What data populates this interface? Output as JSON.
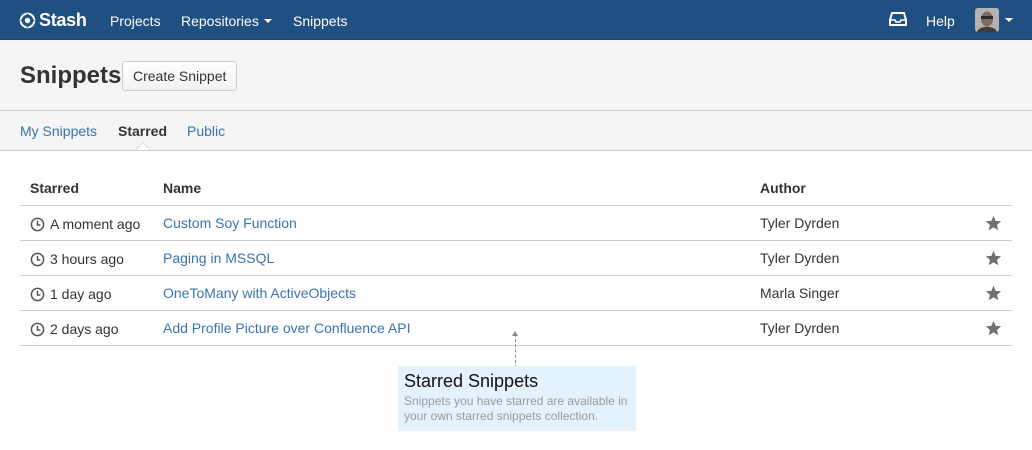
{
  "header": {
    "logo": "Stash",
    "nav": [
      "Projects",
      "Repositories",
      "Snippets"
    ],
    "help": "Help",
    "colors": {
      "bar": "#205081",
      "link": "#3b73af"
    }
  },
  "page": {
    "title": "Snippets",
    "create_button": "Create Snippet"
  },
  "tabs": [
    {
      "label": "My Snippets",
      "active": false
    },
    {
      "label": "Starred",
      "active": true
    },
    {
      "label": "Public",
      "active": false
    }
  ],
  "table": {
    "columns": [
      "Starred",
      "Name",
      "Author"
    ],
    "rows": [
      {
        "starred": "A moment ago",
        "name": "Custom Soy Function",
        "author": "Tyler Dyrden"
      },
      {
        "starred": "3 hours ago",
        "name": "Paging in MSSQL",
        "author": "Tyler Dyrden"
      },
      {
        "starred": "1 day ago",
        "name": "OneToMany with ActiveObjects",
        "author": "Marla Singer"
      },
      {
        "starred": "2 days ago",
        "name": "Add Profile Picture over Confluence API",
        "author": "Tyler Dyrden"
      }
    ]
  },
  "tooltip": {
    "title": "Starred Snippets",
    "body": "Snippets you have starred are available in your own starred snippets collection."
  },
  "icons": [
    "stash-logo-icon",
    "inbox-icon",
    "avatar",
    "clock-icon",
    "star-icon"
  ]
}
